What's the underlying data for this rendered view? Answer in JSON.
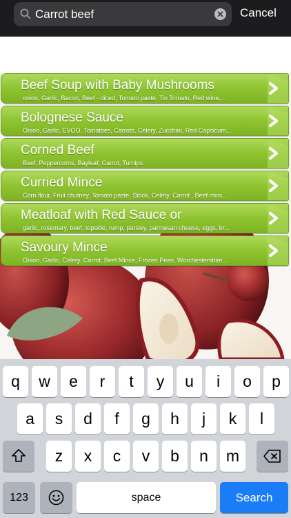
{
  "search": {
    "query": "Carrot beef",
    "cancel_label": "Cancel"
  },
  "results": [
    {
      "title": "Beef Soup with Baby Mushrooms",
      "ingredients": "onion, Garlic, Bacon, Beef - diced, Tomato paste, Tin Tomato, Red wine,..."
    },
    {
      "title": "Bolognese Sauce",
      "ingredients": "Onion, Garlic, EVOO, Tomatoes, Carrots, Celery, Zucchini, Red Capsicum,..."
    },
    {
      "title": "Corned Beef",
      "ingredients": "Beef, Peppercorns, Bayleaf, Carrot, Turnips"
    },
    {
      "title": "Curried Mince",
      "ingredients": "Corn flour, Fruit chutney, Tomato paste, Stock, Celery, Carrot , Beef minc..."
    },
    {
      "title": "Meatloaf with Red Sauce or",
      "ingredients": "garlic, rosemary, beef, topside, rump, parsley, parmesan cheese, eggs, br..."
    },
    {
      "title": "Savoury Mince",
      "ingredients": "Onion, Garlic, Celery, Carrot, Beef Mince, Frozen Peas, Worchestershire..."
    }
  ],
  "keyboard": {
    "row1": [
      "q",
      "w",
      "e",
      "r",
      "t",
      "y",
      "u",
      "i",
      "o",
      "p"
    ],
    "row2": [
      "a",
      "s",
      "d",
      "f",
      "g",
      "h",
      "j",
      "k",
      "l"
    ],
    "row3": [
      "z",
      "x",
      "c",
      "v",
      "b",
      "n",
      "m"
    ],
    "numbers_label": "123",
    "space_label": "space",
    "search_label": "Search"
  },
  "colors": {
    "list_item_green": "#8fc430",
    "search_key_blue": "#1a7df7",
    "keyboard_bg": "#d1d4d9"
  }
}
